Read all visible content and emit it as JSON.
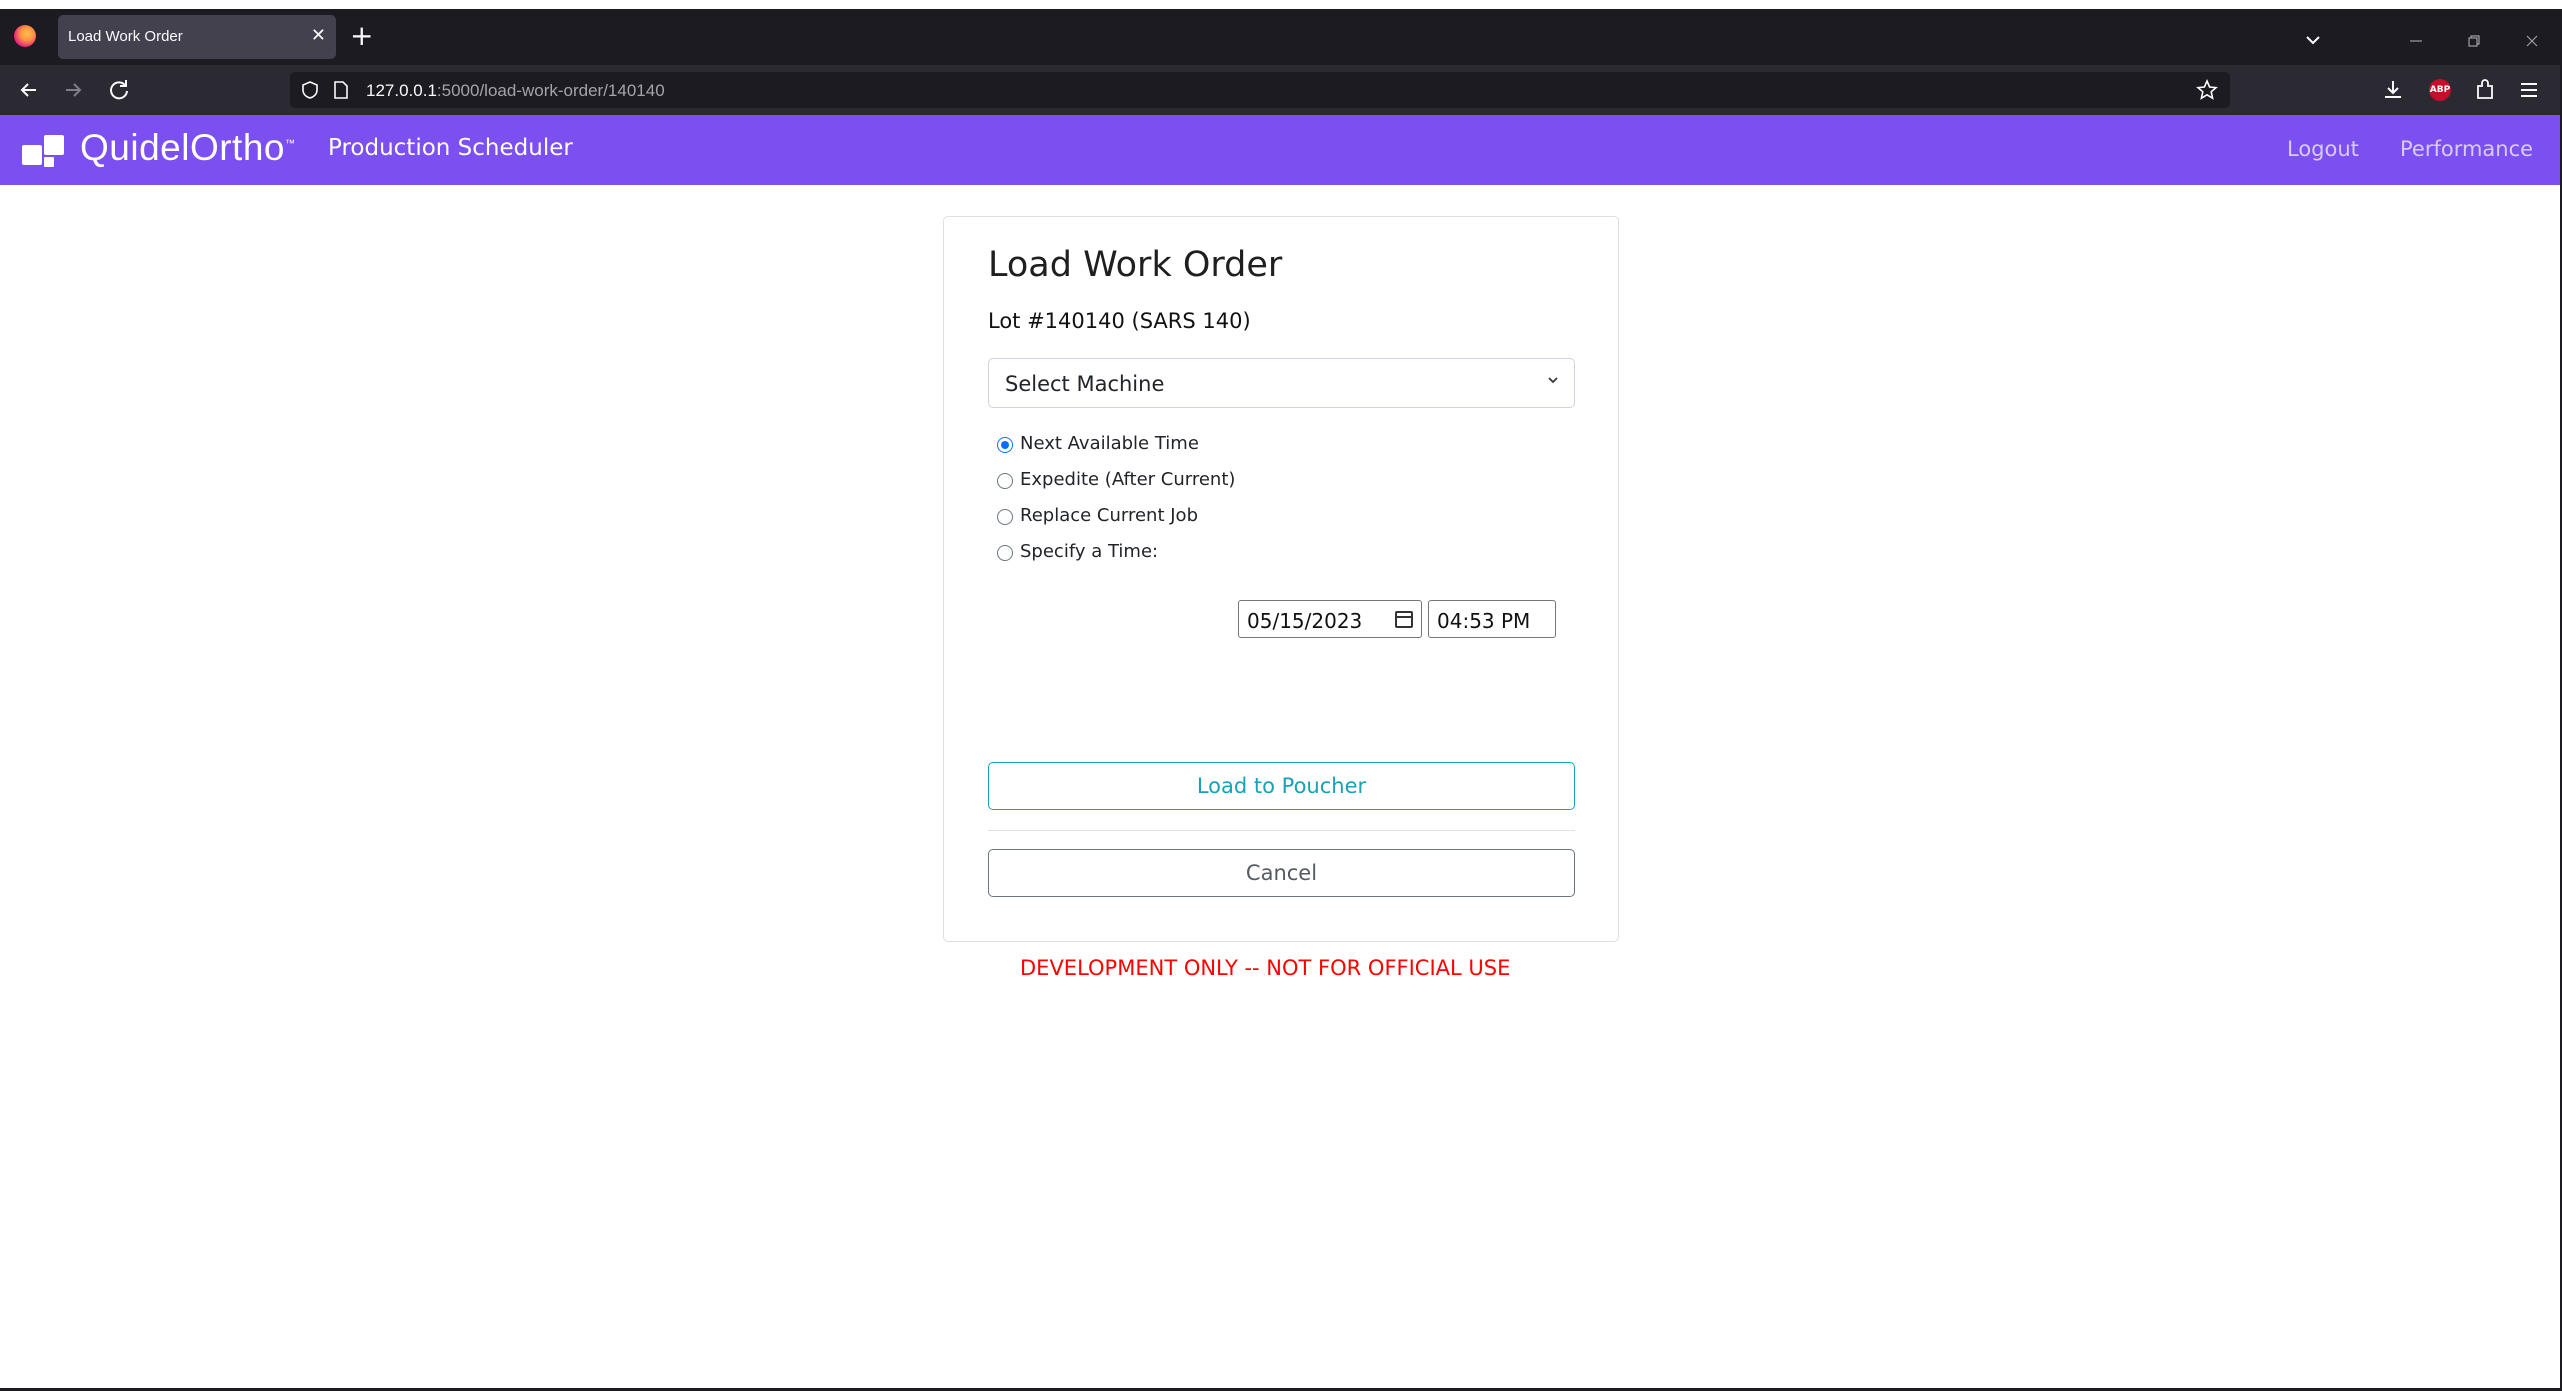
{
  "browser": {
    "tab_title": "Load Work Order",
    "tab_close": "✕",
    "new_tab": "+",
    "url_host": "127.0.0.1",
    "url_path": ":5000/load-work-order/140140",
    "abp_label": "ABP"
  },
  "header": {
    "brand": "QuidelOrtho",
    "brand_tm": "™",
    "app_title": "Production Scheduler",
    "links": {
      "logout": "Logout",
      "performance": "Performance"
    }
  },
  "form": {
    "title": "Load Work Order",
    "lot": "Lot #140140 (SARS 140)",
    "machine_select": {
      "selected": "Select Machine"
    },
    "options": [
      {
        "label": "Next Available Time",
        "checked": true
      },
      {
        "label": "Expedite (After Current)",
        "checked": false
      },
      {
        "label": "Replace Current Job",
        "checked": false
      },
      {
        "label": "Specify a Time:",
        "checked": false
      }
    ],
    "date_value": "05/15/2023",
    "time_value": "04:53  PM",
    "load_button": "Load to Poucher",
    "cancel_button": "Cancel"
  },
  "footer": {
    "warning": "DEVELOPMENT ONLY -- NOT FOR OFFICIAL USE"
  },
  "colors": {
    "header_bg": "#7b4ff0",
    "load_accent": "#17a2b8",
    "warning": "#ff0000",
    "radio_checked": "#0d6efd"
  },
  "icons": [
    "firefox-logo-icon",
    "close-icon",
    "plus-icon",
    "chevron-down-icon",
    "minimize-icon",
    "restore-icon",
    "back-arrow-icon",
    "forward-arrow-icon",
    "reload-icon",
    "shield-icon",
    "page-icon",
    "star-icon",
    "download-icon",
    "extensions-icon",
    "menu-icon",
    "calendar-icon"
  ]
}
